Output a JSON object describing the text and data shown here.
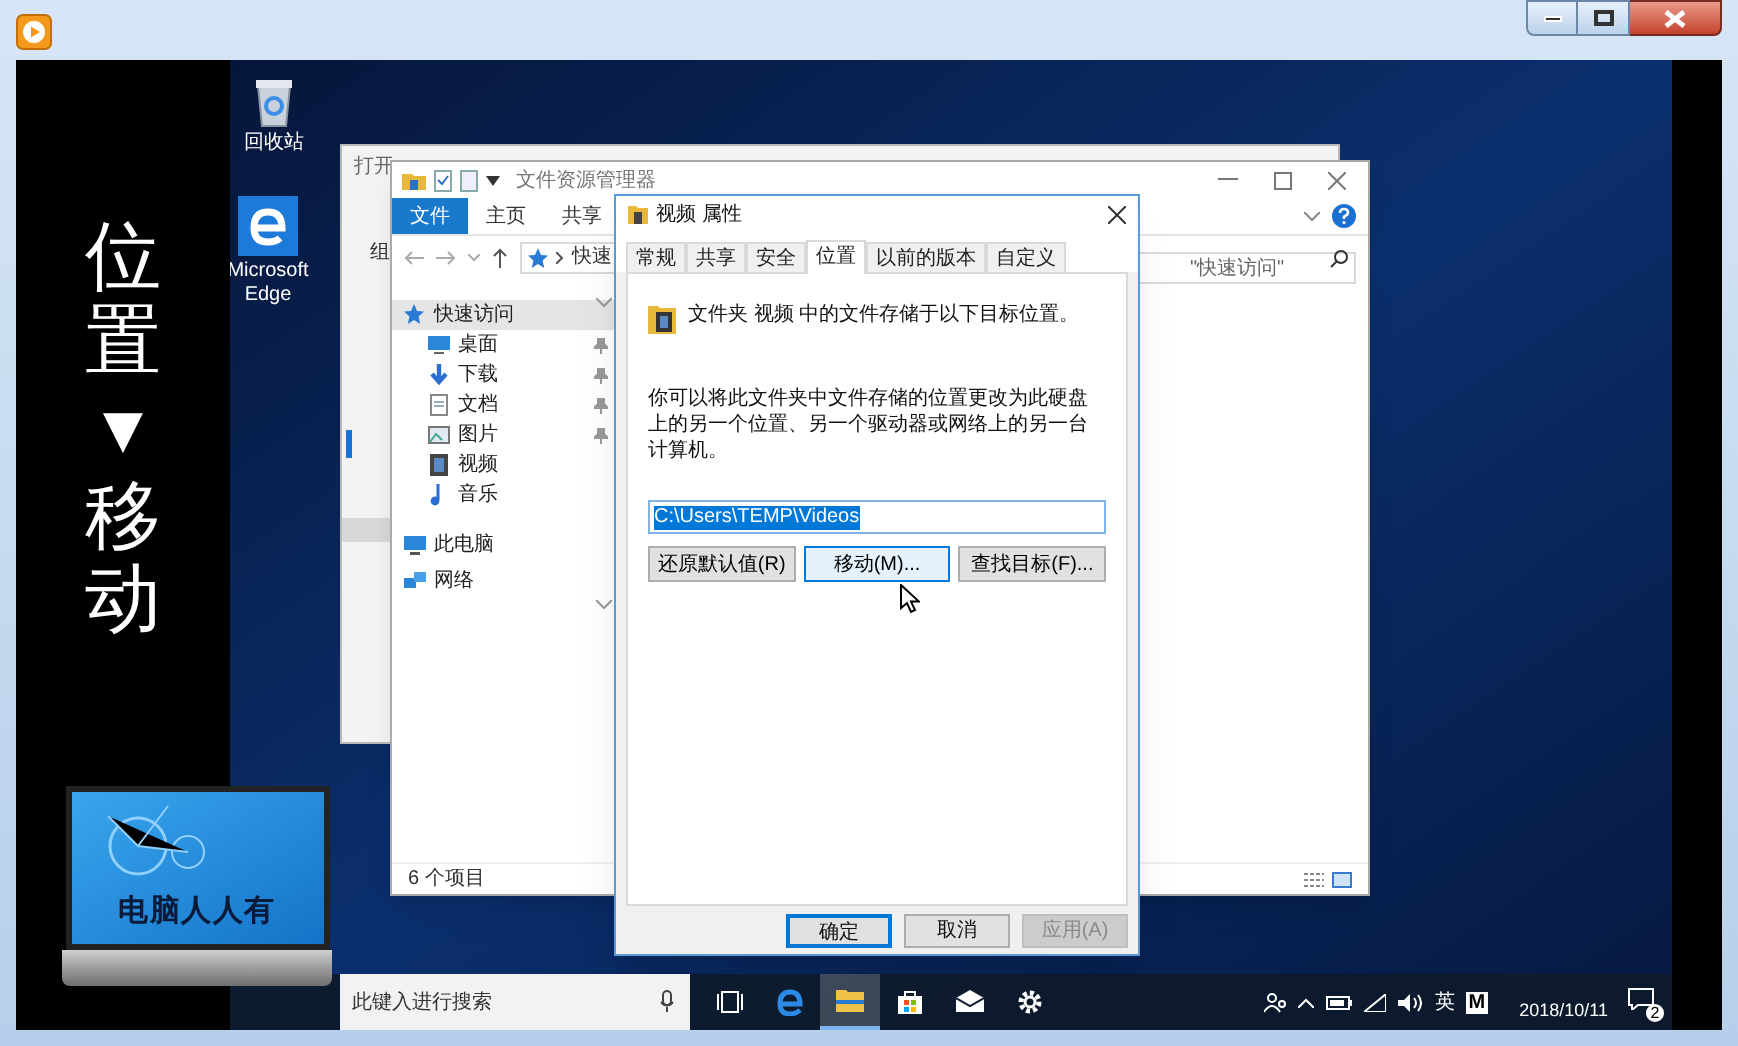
{
  "caption": {
    "top": "位置",
    "arrow": "▼",
    "bottom": "移动"
  },
  "logo": {
    "text": "电脑人人有"
  },
  "desktop_icons": [
    {
      "kind": "recycle",
      "label": "回收站"
    },
    {
      "kind": "edge",
      "label": "Microsoft Edge"
    }
  ],
  "open_window": {
    "title": "打开",
    "toolbar_text": "组"
  },
  "explorer": {
    "title": "文件资源管理器",
    "ribbon_tabs": [
      {
        "label": "文件",
        "selected": true
      },
      {
        "label": "主页",
        "selected": false
      },
      {
        "label": "共享",
        "selected": false
      }
    ],
    "address": "快速",
    "search": {
      "placeholder": "\"快速访问\""
    },
    "nav": [
      {
        "kind": "star",
        "label": "快速访问",
        "selected": true,
        "children": [
          {
            "kind": "desktop",
            "label": "桌面",
            "pinned": true
          },
          {
            "kind": "download",
            "label": "下载",
            "pinned": true
          },
          {
            "kind": "document",
            "label": "文档",
            "pinned": true
          },
          {
            "kind": "picture",
            "label": "图片",
            "pinned": true
          },
          {
            "kind": "video",
            "label": "视频",
            "pinned": false
          },
          {
            "kind": "music",
            "label": "音乐",
            "pinned": false
          }
        ]
      },
      {
        "kind": "pc",
        "label": "此电脑",
        "selected": false
      },
      {
        "kind": "network",
        "label": "网络",
        "selected": false
      }
    ],
    "status": "6 个项目"
  },
  "dialog": {
    "title": "视频 属性",
    "tabs": [
      {
        "label": "常规",
        "selected": false
      },
      {
        "label": "共享",
        "selected": false
      },
      {
        "label": "安全",
        "selected": false
      },
      {
        "label": "位置",
        "selected": true
      },
      {
        "label": "以前的版本",
        "selected": false
      },
      {
        "label": "自定义",
        "selected": false
      }
    ],
    "heading": "文件夹 视频 中的文件存储于以下目标位置。",
    "description": "你可以将此文件夹中文件存储的位置更改为此硬盘上的另一个位置、另一个驱动器或网络上的另一台计算机。",
    "path": "C:\\Users\\TEMP\\Videos",
    "buttons": [
      {
        "label": "还原默认值(R)",
        "hovered": false
      },
      {
        "label": "移动(M)...",
        "hovered": true
      },
      {
        "label": "查找目标(F)...",
        "hovered": false
      }
    ],
    "footer_buttons": [
      {
        "label": "确定",
        "default": true,
        "disabled": false
      },
      {
        "label": "取消",
        "default": false,
        "disabled": false
      },
      {
        "label": "应用(A)",
        "default": false,
        "disabled": true
      }
    ]
  },
  "taskbar": {
    "search": {
      "placeholder": "此键入进行搜索"
    },
    "apps": [
      {
        "kind": "taskview",
        "active": false
      },
      {
        "kind": "edge",
        "active": false
      },
      {
        "kind": "explorer",
        "active": true
      },
      {
        "kind": "store",
        "active": false
      },
      {
        "kind": "mail",
        "active": false
      },
      {
        "kind": "settings",
        "active": false
      }
    ],
    "language": "英",
    "ime": "M",
    "date": "2018/10/11",
    "notifications": "2"
  }
}
